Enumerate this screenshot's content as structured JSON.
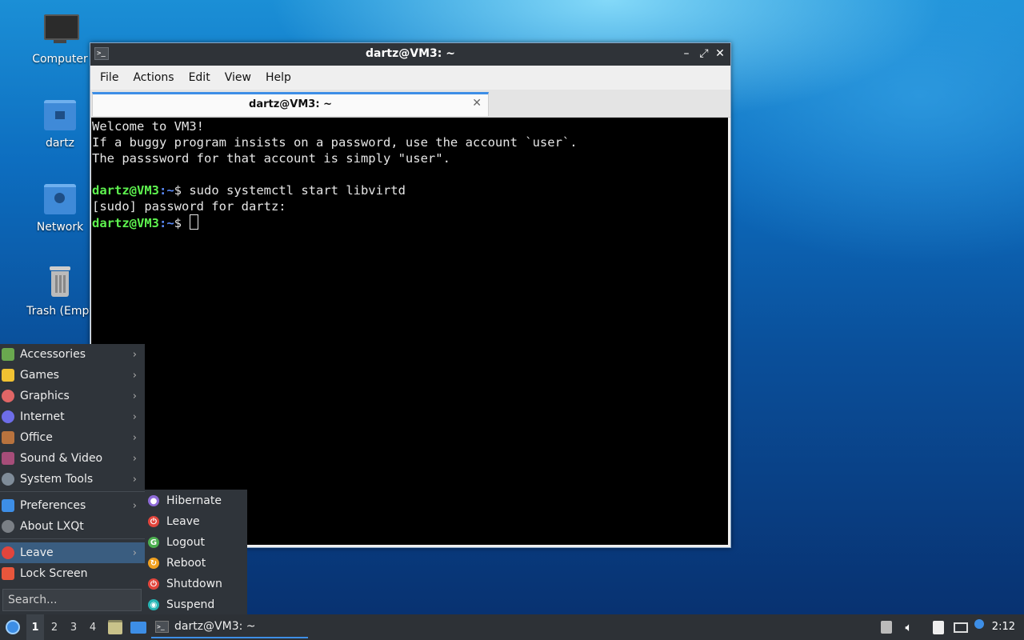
{
  "desktop": {
    "icons": [
      {
        "label": "Computer",
        "icon": "monitor-icon"
      },
      {
        "label": "dartz",
        "icon": "home-folder-icon"
      },
      {
        "label": "Network",
        "icon": "network-folder-icon"
      },
      {
        "label": "Trash (Empt",
        "icon": "trash-icon"
      }
    ]
  },
  "window": {
    "title": "dartz@VM3: ~",
    "controls": {
      "minimize": "–",
      "maximize": "⤢",
      "close": "✕"
    },
    "menu": [
      "File",
      "Actions",
      "Edit",
      "View",
      "Help"
    ],
    "tab": {
      "title": "dartz@VM3: ~",
      "close": "✕"
    },
    "terminal": {
      "lines": [
        "Welcome to VM3!",
        "If a buggy program insists on a password, use the account `user`.",
        "The passsword for that account is simply \"user\".",
        ""
      ],
      "prompt_user": "dartz@VM3",
      "prompt_path": ":~",
      "prompt_symbol": "$",
      "command": " sudo systemctl start libvirtd",
      "sudo_line": "[sudo] password for dartz:",
      "prompt_path_2": ":~",
      "prompt_symbol_2": "$ "
    }
  },
  "start_menu": {
    "items": [
      {
        "label": "Accessories",
        "icon": "accessories-icon",
        "color": "#6aa84f"
      },
      {
        "label": "Games",
        "icon": "games-icon",
        "color": "#f1c232"
      },
      {
        "label": "Graphics",
        "icon": "graphics-icon",
        "color": "#e06666"
      },
      {
        "label": "Internet",
        "icon": "internet-icon",
        "color": "#6d6de8"
      },
      {
        "label": "Office",
        "icon": "office-icon",
        "color": "#b8733e"
      },
      {
        "label": "Sound & Video",
        "icon": "sound-video-icon",
        "color": "#a64d79"
      },
      {
        "label": "System Tools",
        "icon": "system-tools-icon",
        "color": "#7f8c99"
      }
    ],
    "preferences": "Preferences",
    "about": "About LXQt",
    "leave": "Leave",
    "lock": "Lock Screen",
    "search_placeholder": "Search...",
    "arrow": "›"
  },
  "leave_submenu": {
    "items": [
      {
        "label": "Hibernate",
        "icon": "hibernate-icon",
        "color": "#8e6bd8"
      },
      {
        "label": "Leave",
        "icon": "leave-power-icon",
        "color": "#e2453c"
      },
      {
        "label": "Logout",
        "icon": "logout-icon",
        "color": "#4caf50"
      },
      {
        "label": "Reboot",
        "icon": "reboot-icon",
        "color": "#f0a020"
      },
      {
        "label": "Shutdown",
        "icon": "shutdown-icon",
        "color": "#e2453c"
      },
      {
        "label": "Suspend",
        "icon": "suspend-icon",
        "color": "#26b5b5"
      }
    ]
  },
  "taskbar": {
    "workspaces": [
      "1",
      "2",
      "3",
      "4"
    ],
    "task_label": "dartz@VM3: ~",
    "clock": "2:12"
  }
}
